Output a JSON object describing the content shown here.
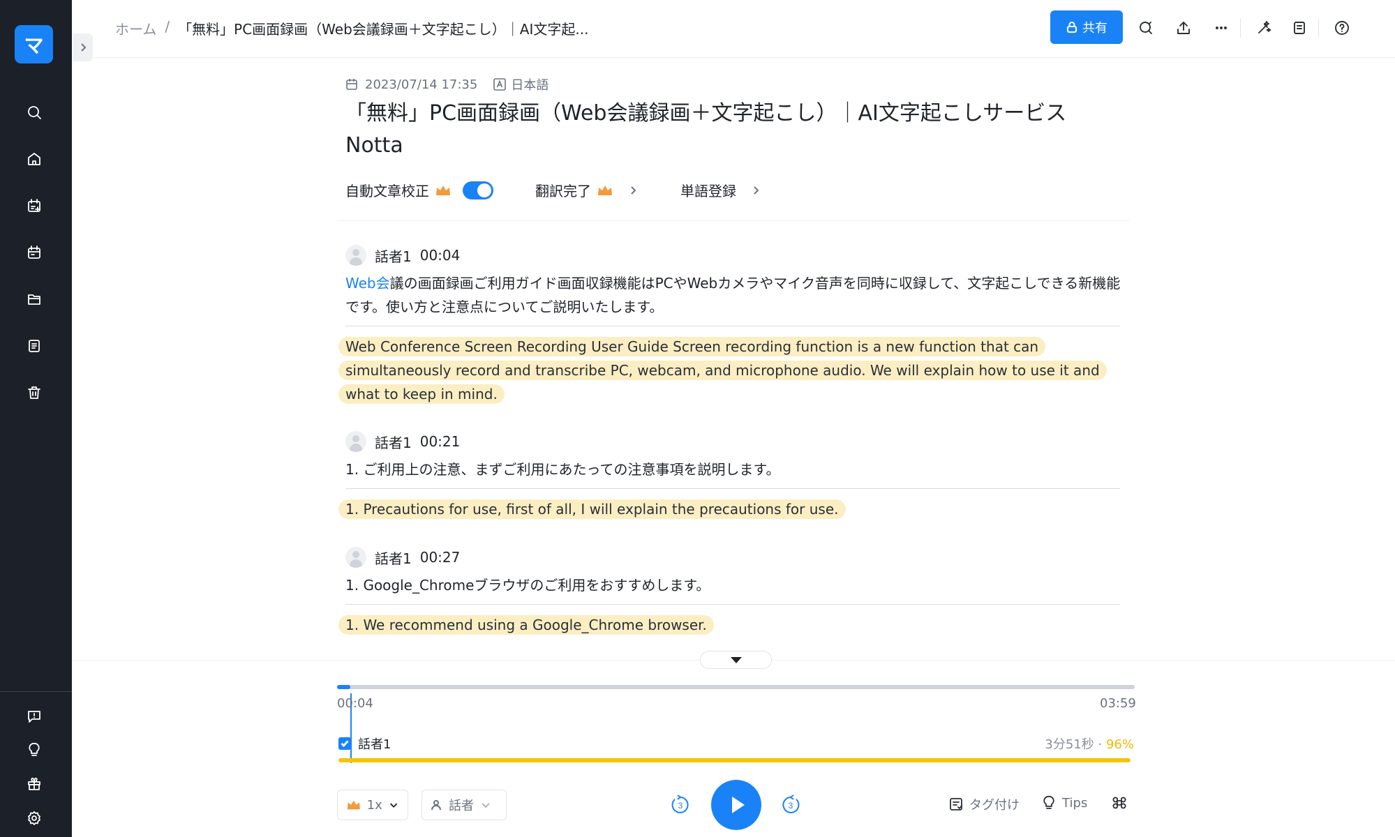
{
  "sidebar": {
    "logo": "マ",
    "icons": [
      "search-icon",
      "home-icon",
      "calendar-add-icon",
      "calendar-icon",
      "folder-icon",
      "document-icon",
      "trash-icon",
      "feedback-icon",
      "lightbulb-icon",
      "gift-icon",
      "settings-icon"
    ]
  },
  "header": {
    "breadcrumb_home": "ホーム",
    "breadcrumb_sep": "/",
    "breadcrumb_current": "「無料」PC画面録画（Web会議録画＋文字起こし）｜AI文字起...",
    "share_label": "共有"
  },
  "doc": {
    "date": "2023/07/14 17:35",
    "language": "日本語",
    "title": "「無料」PC画面録画（Web会議録画＋文字起こし）｜AI文字起こしサービスNotta"
  },
  "options": {
    "auto_correct": "自動文章校正",
    "translation": "翻訳完了",
    "word_register": "単語登録"
  },
  "segments": [
    {
      "speaker": "話者1",
      "time": "00:04",
      "ja_highlight": "Web会",
      "ja": "議の画面録画ご利用ガイド画面収録機能はPCやWebカメラやマイク音声を同時に収録して、文字起こしできる新機能です。使い方と注意点についてご説明いたします。",
      "en": "Web Conference Screen Recording User Guide Screen recording function is a new function that can simultaneously record and transcribe PC, webcam, and microphone audio. We will explain how to use it and what to keep in mind."
    },
    {
      "speaker": "話者1",
      "time": "00:21",
      "ja_highlight": "",
      "ja": "1. ご利用上の注意、まずご利用にあたっての注意事項を説明します。",
      "en": "1. Precautions for use, first of all, I will explain the precautions for use."
    },
    {
      "speaker": "話者1",
      "time": "00:27",
      "ja_highlight": "",
      "ja": "1. Google_Chromeブラウザのご利用をおすすめします。",
      "en": "1. We recommend using a Google_Chrome browser."
    }
  ],
  "player": {
    "current_time": "00:04",
    "total_time": "03:59",
    "progress": 0.017,
    "speaker_track": {
      "name": "話者1",
      "duration": "3分51秒",
      "dot": "·",
      "percent": "96%"
    },
    "speed": "1x",
    "speaker_filter": "話者",
    "skip_back": "3",
    "skip_forward": "3",
    "tag_label": "タグ付け",
    "tips_label": "Tips"
  },
  "colors": {
    "accent": "#1a82f7",
    "sidebar_bg": "#1c2029",
    "highlight": "#fbeec3",
    "speaker_bar": "#f5c400"
  }
}
